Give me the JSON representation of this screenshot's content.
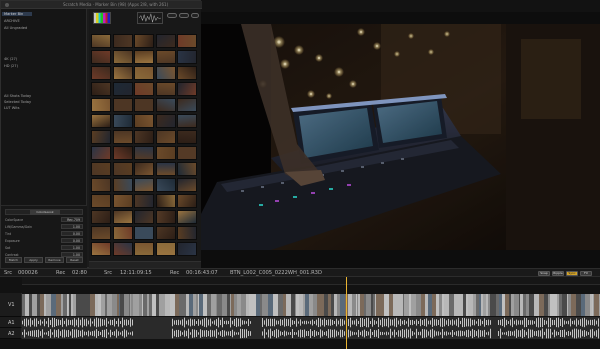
{
  "browser": {
    "title": "Scratch Media · Marker Bin (98) (Apps 2/8, with 261)",
    "bins": [
      {
        "label": "Marker Bin",
        "selected": true
      },
      {
        "label": "ARCHIVE",
        "selected": false
      },
      {
        "label": "All Ungraded",
        "selected": false
      },
      {
        "label": "4K (27)",
        "selected": false
      },
      {
        "label": "HD (27)",
        "selected": false
      },
      {
        "label": "All Shots Today",
        "selected": false
      },
      {
        "label": "Selected Today",
        "selected": false
      },
      {
        "label": "LUT Wits",
        "selected": false
      }
    ],
    "color_tab": "Color&Look",
    "params": [
      {
        "label": "ColorSpace",
        "value": "Rec.709"
      },
      {
        "label": "Lift/Gamma/Gain",
        "value": "1.00"
      },
      {
        "label": "Tint",
        "value": "0.00"
      },
      {
        "label": "Exposure",
        "value": "0.00"
      },
      {
        "label": "Sat",
        "value": "1.00"
      },
      {
        "label": "Contrast",
        "value": "1.00"
      }
    ],
    "color_buttons": [
      "Match",
      "Apply",
      "Remove",
      "Reset"
    ]
  },
  "transport": {
    "src_label": "Src",
    "src_value": "000026",
    "rec1_label": "Rec",
    "rec1_value": "02:80",
    "src2_label": "Src",
    "src2_value": "12:11:09:15",
    "rec2_label": "Rec",
    "rec2_value": "00:16:43:07",
    "clip_name": "BTN_L002_C005_0222WH_001.R3D",
    "buttons": [
      "Snap",
      "Ripple",
      "Sync",
      "FX"
    ]
  },
  "timeline": {
    "tracks": [
      "V1",
      "A1",
      "A2"
    ]
  },
  "colors": {
    "accent": "#e9b431",
    "selection": "#2d3a4d",
    "button": "#3a3a3a",
    "highlight_button": "#d2a32a"
  }
}
